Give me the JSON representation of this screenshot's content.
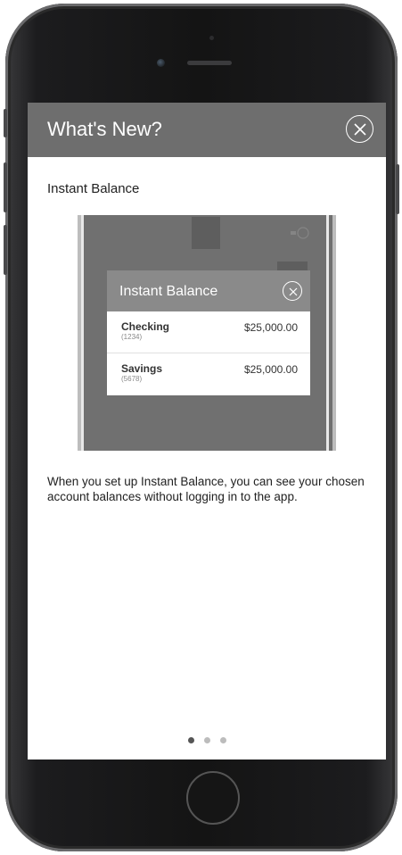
{
  "header": {
    "title": "What's New?",
    "close_icon": "close-circle-icon",
    "background": "#6e6e6e"
  },
  "content": {
    "section_title": "Instant Balance",
    "description": "When you set up Instant Balance, you can see your chosen account balances without logging in to the app."
  },
  "preview": {
    "popup_title": "Instant Balance",
    "popup_close_icon": "close-circle-icon",
    "accounts": [
      {
        "name": "Checking",
        "number": "(1234)",
        "balance": "$25,000.00"
      },
      {
        "name": "Savings",
        "number": "(5678)",
        "balance": "$25,000.00"
      }
    ]
  },
  "pagination": {
    "total": 3,
    "active_index": 0
  },
  "device": {
    "home_button_icon": "home-button"
  }
}
